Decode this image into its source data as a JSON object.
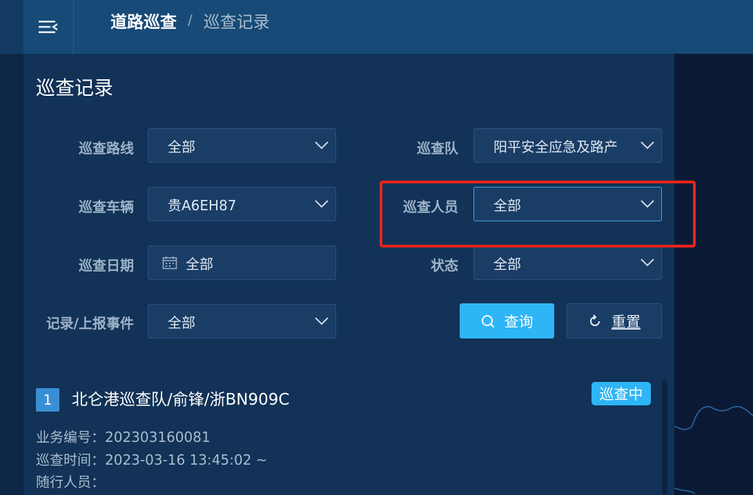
{
  "header": {
    "breadcrumb_main": "道路巡查",
    "breadcrumb_sep": "/",
    "breadcrumb_current": "巡查记录"
  },
  "panel": {
    "title": "巡查记录"
  },
  "filters": {
    "route": {
      "label": "巡查路线",
      "value": "全部"
    },
    "team": {
      "label": "巡查队",
      "value": "阳平安全应急及路产"
    },
    "vehicle": {
      "label": "巡查车辆",
      "value": "贵A6EH87"
    },
    "personnel": {
      "label": "巡查人员",
      "value": "全部"
    },
    "date": {
      "label": "巡查日期",
      "value": "全部"
    },
    "status": {
      "label": "状态",
      "value": "全部"
    },
    "event": {
      "label": "记录/上报事件",
      "value": "全部"
    }
  },
  "buttons": {
    "query": "查询",
    "reset": "重置"
  },
  "record": {
    "index": "1",
    "title": "北仑港巡查队/俞锋/浙BN909C",
    "status": "巡查中",
    "business_no": "业务编号：202303160081",
    "patrol_time": "巡查时间：2023-03-16 13:45:02 ~",
    "companions": "随行人员："
  },
  "colors": {
    "accent": "#2eb5f5",
    "highlight": "#e8231e",
    "panel_bg": "#123257",
    "topbar_bg": "#174a76"
  },
  "icons": {
    "menu": "menu-fold-icon",
    "chevron": "chevron-down-icon",
    "calendar": "calendar-icon",
    "search": "search-icon",
    "reset": "refresh-icon"
  }
}
